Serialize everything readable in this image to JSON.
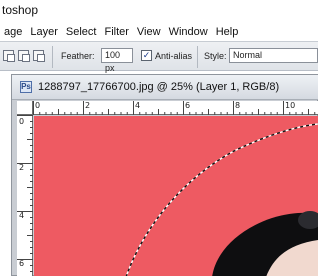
{
  "app": {
    "title_fragment": "toshop"
  },
  "menu": {
    "items": [
      "age",
      "Layer",
      "Select",
      "Filter",
      "View",
      "Window",
      "Help"
    ]
  },
  "options_bar": {
    "feather_label": "Feather:",
    "feather_value": "100 px",
    "antialias_label": "Anti-alias",
    "antialias_checked": true,
    "style_label": "Style:",
    "style_value": "Normal"
  },
  "document": {
    "title": "1288797_17766700.jpg @ 25% (Layer 1, RGB/8)",
    "icon": "document-icon",
    "ruler_h_labels": [
      "0",
      "2",
      "4",
      "6",
      "8",
      "10"
    ],
    "ruler_v_labels": [
      "0",
      "2",
      "4",
      "6"
    ],
    "canvas_color": "#ee5a62"
  }
}
